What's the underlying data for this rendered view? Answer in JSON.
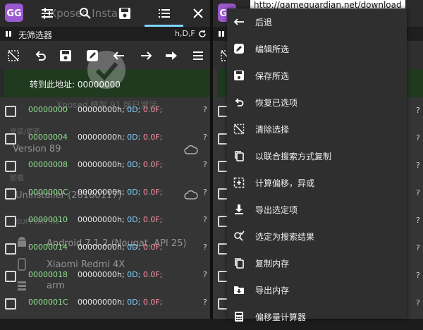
{
  "left_panel": {
    "top_bar": {
      "ghost_title": "Xposed Installe"
    },
    "filter_bar": {
      "label": "无筛选器",
      "types": "h,D,F"
    },
    "goto": {
      "label": "转到此地址: 00000000"
    },
    "rows": [
      {
        "address": "00000000",
        "hex": "00000000h;",
        "dword": "0D;",
        "float": "0.0F;",
        "q": "?"
      },
      {
        "address": "00000004",
        "hex": "00000000h;",
        "dword": "0D;",
        "float": "0.0F;",
        "q": "?"
      },
      {
        "address": "00000008",
        "hex": "00000000h;",
        "dword": "0D;",
        "float": "0.0F;",
        "q": "?"
      },
      {
        "address": "0000000C",
        "hex": "00000000h;",
        "dword": "0D;",
        "float": "0.0F;",
        "q": "?"
      },
      {
        "address": "00000010",
        "hex": "00000000h;",
        "dword": "0D;",
        "float": "0.0F;",
        "q": "?"
      },
      {
        "address": "00000014",
        "hex": "00000000h;",
        "dword": "0D;",
        "float": "0.0F;",
        "q": "?"
      },
      {
        "address": "00000018",
        "hex": "00000000h;",
        "dword": "0D;",
        "float": "0.0F;",
        "q": "?"
      },
      {
        "address": "0000001C",
        "hex": "00000000h;",
        "dword": "0D;",
        "float": "0.0F;",
        "q": "?"
      }
    ],
    "ghost_texts": {
      "framework": "Xposed 框架 91 版已激活",
      "install": "安装/更新",
      "version": "Version 89",
      "uninstall": "卸载",
      "uninstaller": "Uninstaller (20180117)",
      "support": "SUPPORT X2",
      "android": "Android 7.1.2 (Nougat, API 25)",
      "device": "Xiaomi Redmi 4X",
      "arch": "arm"
    }
  },
  "right_panel": {
    "url": "http://gameguardian.net/download",
    "menu": [
      {
        "icon": "back-arrow-icon",
        "label": "后退"
      },
      {
        "icon": "edit-selected-icon",
        "label": "编辑所选"
      },
      {
        "icon": "save-icon",
        "label": "保存所选"
      },
      {
        "icon": "restore-icon",
        "label": "恢复已选项"
      },
      {
        "icon": "clear-selection-icon",
        "label": "清除选择"
      },
      {
        "icon": "copy-icon",
        "label": "以联合搜索方式复制"
      },
      {
        "icon": "calc-offset-icon",
        "label": "计算偏移，异或"
      },
      {
        "icon": "export-icon",
        "label": "导出选定项"
      },
      {
        "icon": "search-result-icon",
        "label": "选定为搜索结果"
      },
      {
        "icon": "copy-memory-icon",
        "label": "复制内存"
      },
      {
        "icon": "dump-memory-icon",
        "label": "导出内存"
      },
      {
        "icon": "offset-calculator-icon",
        "label": "偏移量计算器"
      }
    ]
  }
}
